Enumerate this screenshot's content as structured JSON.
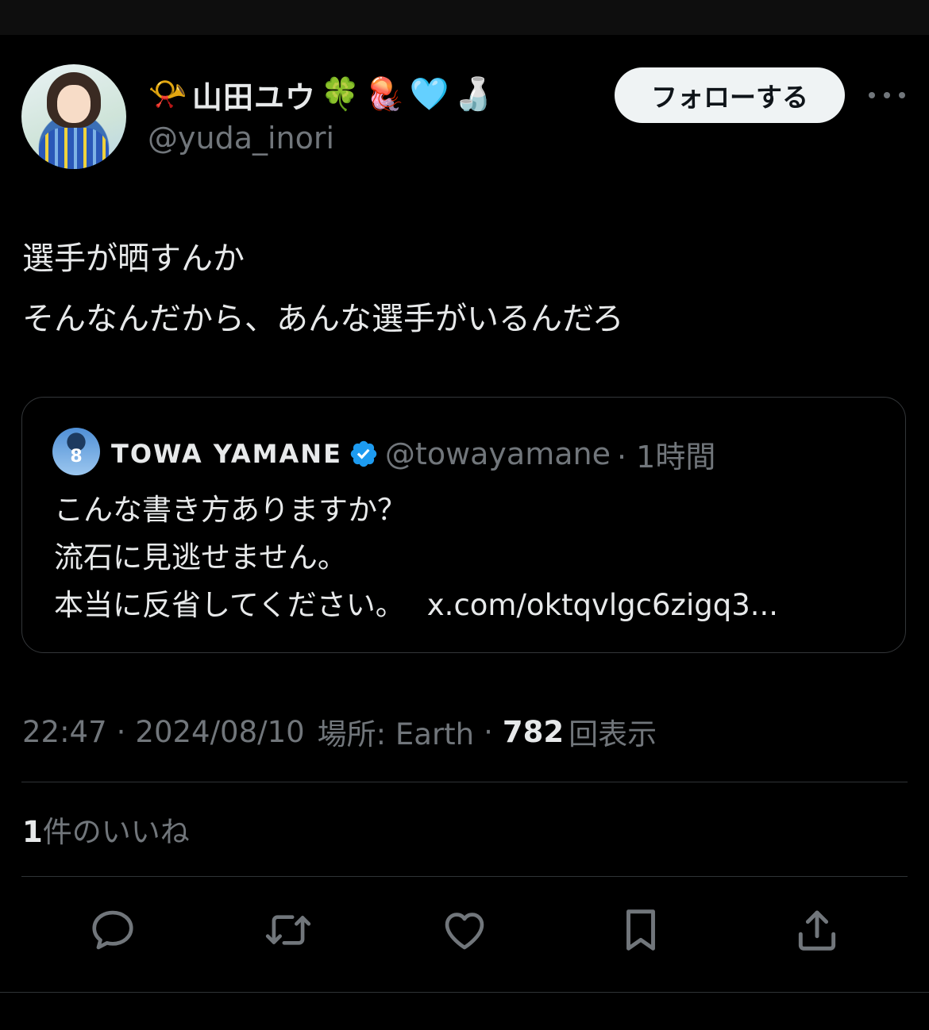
{
  "author": {
    "display_name": "山田ユウ",
    "emojis": [
      "📯",
      "🍀",
      "🪼",
      "🩵",
      "🍶"
    ],
    "handle": "@yuda_inori",
    "follow_label": "フォローする"
  },
  "tweet": {
    "lines": [
      "選手が晒すんか",
      "そんなんだから、あんな選手がいるんだろ"
    ]
  },
  "quote": {
    "name": "TOWA YAMANE",
    "handle": "@towayamane",
    "time": "· 1時間",
    "avatar_number": "8",
    "lines": [
      "こんな書き方ありますか？",
      "流石に見逃せません。",
      "本当に反省してください。"
    ],
    "link": "x.com/oktqvlgc6zigq3..."
  },
  "meta": {
    "time": "22:47",
    "date": "2024/08/10",
    "location": "場所: Earth",
    "views_count": "782",
    "views_label": "回表示",
    "sep": "·"
  },
  "likes": {
    "count": "1",
    "label": "件のいいね"
  },
  "colors": {
    "background": "#000000",
    "text": "#e7e9ea",
    "muted": "#71767b",
    "verified": "#1d9bf0",
    "follow_bg": "#eff3f4"
  },
  "icons": [
    "more-icon",
    "verified-icon",
    "reply-icon",
    "repost-icon",
    "like-icon",
    "bookmark-icon",
    "share-icon"
  ]
}
